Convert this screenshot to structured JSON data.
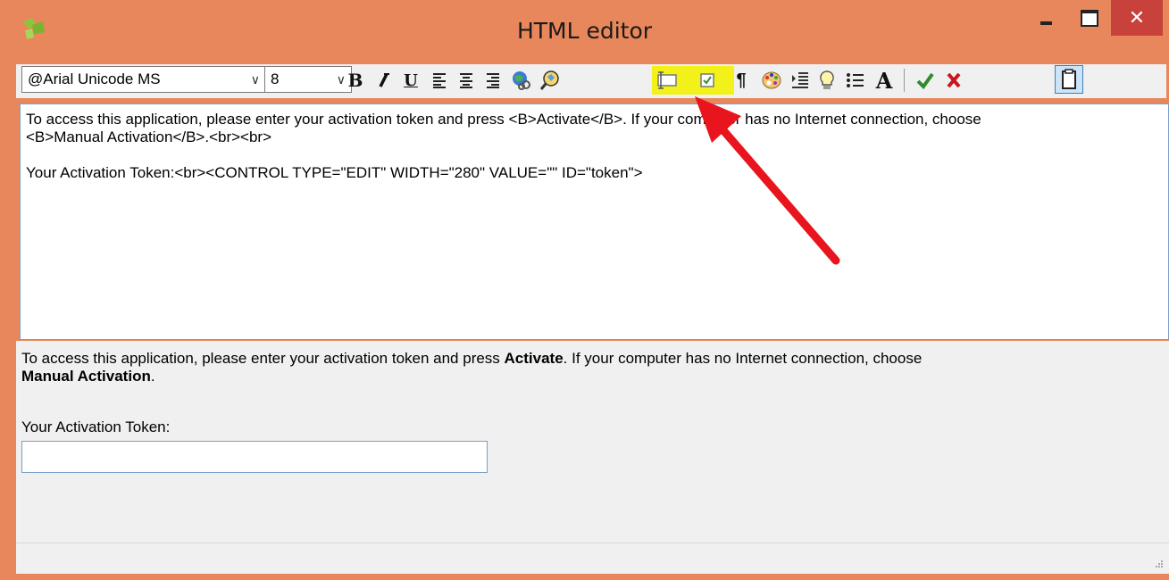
{
  "window": {
    "title": "HTML editor",
    "close_glyph": "✕"
  },
  "toolbar": {
    "font": "@Arial Unicode MS",
    "size": "8",
    "dropdown_glyph": "∨",
    "bold_label": "B",
    "underline_label": "U",
    "pilcrow_label": "¶",
    "font_icon_label": "A",
    "highlight_color": "#f2f21a"
  },
  "source": {
    "line1": "To access this application, please enter your activation token and press <B>Activate</B>. If your computer has no Internet connection, choose",
    "line2": "<B>Manual Activation</B>.<br><br>",
    "line3": "Your Activation Token:<br><CONTROL TYPE=\"EDIT\" WIDTH=\"280\" VALUE=\"\" ID=\"token\">"
  },
  "preview": {
    "text_before": "To access this application, please enter your activation token and press ",
    "bold1": "Activate",
    "text_middle": ". If your computer has no Internet connection, choose",
    "bold2": "Manual Activation",
    "text_end": ".",
    "token_label": "Your Activation Token:",
    "token_value": ""
  },
  "annotation": {
    "arrow_color": "#e8141e"
  }
}
